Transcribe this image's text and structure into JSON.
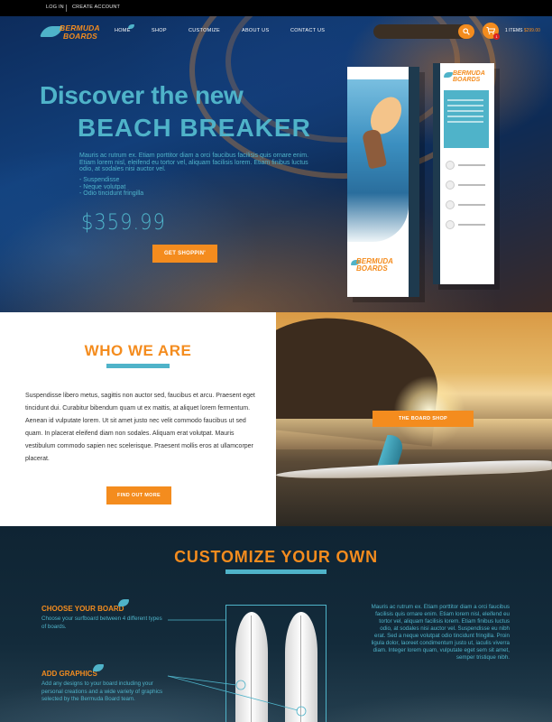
{
  "topbar": {
    "login": "LOG IN",
    "create_account": "CREATE ACCOUNT"
  },
  "brand": {
    "line1": "BERMUDA",
    "line2": "BOARDS"
  },
  "nav": {
    "items": [
      "HOME",
      "SHOP",
      "CUSTOMIZE",
      "ABOUT US",
      "CONTACT US"
    ],
    "active": "HOME"
  },
  "search": {
    "placeholder": ""
  },
  "cart": {
    "count_label": "1 ITEMS",
    "total": "$299.00",
    "badge": "1"
  },
  "hero": {
    "title_line1": "Discover the new",
    "title_line2": "BEACH BREAKER",
    "description": "Mauris ac rutrum ex. Etiam porttitor diam a orci faucibus facilisis quis ornare enim. Etiam lorem nisl, eleifend eu tortor vel, aliquam facilisis lorem. Etiam finibus luctus odio, at sodales nisi auctor vel.",
    "bullets": [
      "- Suspendisse",
      "- Neque volutpat",
      "- Odio tincidunt fringilla"
    ],
    "price": "$359.99",
    "cta": "GET SHOPPIN'",
    "box_logo1": "BERMUDA",
    "box_logo2": "BOARDS"
  },
  "who": {
    "title": "WHO WE ARE",
    "text": "Suspendisse libero metus, sagittis non auctor sed, faucibus et arcu. Praesent eget tincidunt dui. Curabitur bibendum quam ut ex mattis, at aliquet lorem fermentum. Aenean id vulputate lorem. Ut sit amet justo nec velit commodo faucibus ut sed quam. In placerat eleifend diam non sodales. Aliquam erat volutpat. Mauris vestibulum commodo sapien nec scelerisque. Praesent mollis eros at ullamcorper placerat.",
    "button": "FIND OUT MORE",
    "shop_button": "THE BOARD SHOP"
  },
  "customize": {
    "title": "CUSTOMIZE YOUR OWN",
    "step1_title": "CHOOSE YOUR BOARD",
    "step1_text": "Choose your surfboard between 4 different types of boards.",
    "step2_title": "ADD GRAPHICS",
    "step2_text": "Add any designs to your board including your personal creations and a wide variety of graphics selected by the Bermuda Board team.",
    "right_text": "Mauris ac rutrum ex. Etiam porttitor diam a orci faucibus facilisis quis ornare enim. Etiam lorem nisl, eleifend eu tortor vel, aliquam facilisis lorem. Etiam finibus luctus odio, at sodales nisi auctor vel. Suspendisse eu nibh erat. Sed a neque volutpat odio tincidunt fringilla. Proin ligula dolor, laoreet condimentum justo ut, iaculis viverra diam. Integer lorem quam, vulputate eget sem sit amet, semper tristique nibh."
  },
  "colors": {
    "accent": "#f48c1e",
    "brand_blue": "#4fb3c9",
    "dark": "#0f2433"
  }
}
